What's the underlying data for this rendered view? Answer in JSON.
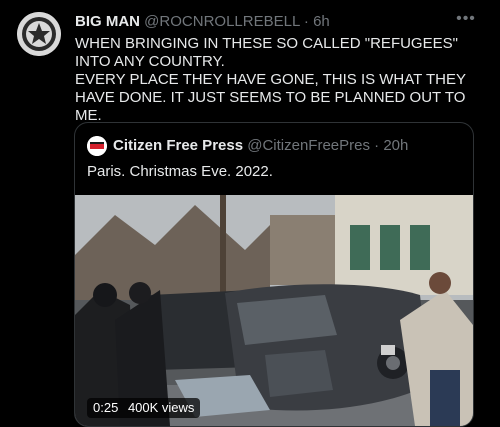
{
  "tweet": {
    "author_name": "BIG MAN",
    "author_handle": "@ROCNROLLREBELL",
    "separator": "·",
    "time": "6h",
    "more_icon": "more-horizontal-icon",
    "text_line1": "WHEN BRINGING IN THESE SO CALLED \"REFUGEES\" INTO ANY COUNTRY.",
    "text_line2": "EVERY PLACE THEY HAVE GONE, THIS IS WHAT THEY HAVE DONE. IT JUST SEEMS TO BE PLANNED OUT TO ME."
  },
  "quote": {
    "author_name": "Citizen Free Press",
    "author_handle": "@CitizenFreePres",
    "separator": "·",
    "time": "20h",
    "text": "Paris. Christmas Eve. 2022.",
    "video": {
      "duration": "0:25",
      "views": "400K views"
    }
  },
  "colors": {
    "background": "#000000",
    "text_primary": "#e7e9ea",
    "text_secondary": "#71767b",
    "border": "#2f3336",
    "quote_avatar_accent": "#d4202c"
  }
}
